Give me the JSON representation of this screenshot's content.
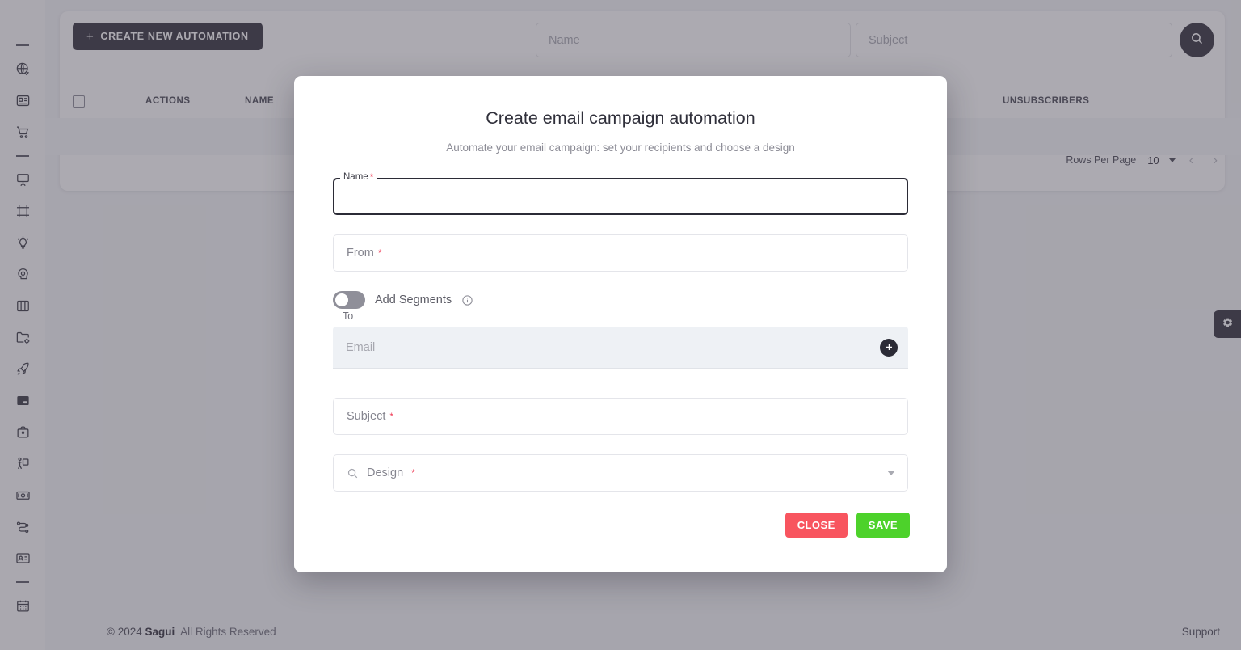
{
  "sidebar": {
    "items": [
      {
        "name": "divider-top",
        "icon": "divider"
      },
      {
        "name": "globe-check",
        "icon": "globe-check-icon",
        "label": "Website"
      },
      {
        "name": "content-card",
        "icon": "content-card-icon",
        "label": "Content"
      },
      {
        "name": "shopping-cart",
        "icon": "shopping-cart-icon",
        "label": "Shop"
      },
      {
        "name": "divider-mid",
        "icon": "divider"
      },
      {
        "name": "presentation",
        "icon": "presentation-board-icon",
        "label": "Presentation"
      },
      {
        "name": "frame",
        "icon": "frame-crop-icon",
        "label": "Frame"
      },
      {
        "name": "lightbulb",
        "icon": "lightbulb-icon",
        "label": "Ideas"
      },
      {
        "name": "brain-idea",
        "icon": "brain-idea-icon",
        "label": "Insights"
      },
      {
        "name": "book",
        "icon": "book-icon",
        "label": "Library"
      },
      {
        "name": "folder-settings",
        "icon": "folder-settings-icon",
        "label": "Projects"
      },
      {
        "name": "rocket",
        "icon": "rocket-icon",
        "label": "Launch"
      },
      {
        "name": "campaign-card",
        "icon": "campaign-card-icon",
        "label": "Campaigns"
      },
      {
        "name": "briefcase",
        "icon": "briefcase-icon",
        "label": "Business"
      },
      {
        "name": "presenter",
        "icon": "presenter-icon",
        "label": "Training"
      },
      {
        "name": "money",
        "icon": "money-icon",
        "label": "Billing"
      },
      {
        "name": "workflow",
        "icon": "workflow-icon",
        "label": "Automations"
      },
      {
        "name": "id-card",
        "icon": "id-card-icon",
        "label": "Contacts"
      },
      {
        "name": "divider-bottom",
        "icon": "divider"
      },
      {
        "name": "calendar",
        "icon": "calendar-icon",
        "label": "Calendar"
      }
    ]
  },
  "toolbar": {
    "create_button_label": "CREATE NEW AUTOMATION",
    "create_button_plus": "+",
    "name_filter_placeholder": "Name",
    "subject_filter_placeholder": "Subject",
    "search_icon": "search-icon"
  },
  "table": {
    "columns": [
      "ACTIONS",
      "NAME",
      "UNSUBSCRIBERS"
    ],
    "select_all_checkbox": "unchecked",
    "rows": []
  },
  "pagination": {
    "rows_per_page_label": "Rows Per Page",
    "rows_per_page_value": "10",
    "prev_arrow": "‹",
    "next_arrow": "›"
  },
  "footer": {
    "copyright_symbol": "©",
    "year": "2024",
    "brand": "Sagui",
    "rights": "All Rights Reserved",
    "support_label": "Support"
  },
  "settings_tab": {
    "icon": "gear-icon"
  },
  "modal": {
    "title": "Create email campaign automation",
    "subtitle": "Automate your email campaign: set your recipients and choose a design",
    "required_marker": "*",
    "name": {
      "label": "Name",
      "value": "",
      "focused": true
    },
    "from": {
      "placeholder": "From"
    },
    "segments": {
      "label": "Add Segments",
      "state": "off",
      "info_icon": "info-icon"
    },
    "to": {
      "label": "To",
      "email_placeholder": "Email",
      "add_button_icon": "plus-icon"
    },
    "subject": {
      "placeholder": "Subject"
    },
    "design": {
      "placeholder": "Design",
      "search_icon": "search-icon",
      "caret_icon": "chevron-down-icon"
    },
    "actions": {
      "close_label": "CLOSE",
      "save_label": "SAVE"
    }
  },
  "colors": {
    "dark": "#33303c",
    "close_red": "#f8555f",
    "save_green": "#4dd22b",
    "required_red": "#f0405a",
    "overlay": "#9e9aa1"
  }
}
